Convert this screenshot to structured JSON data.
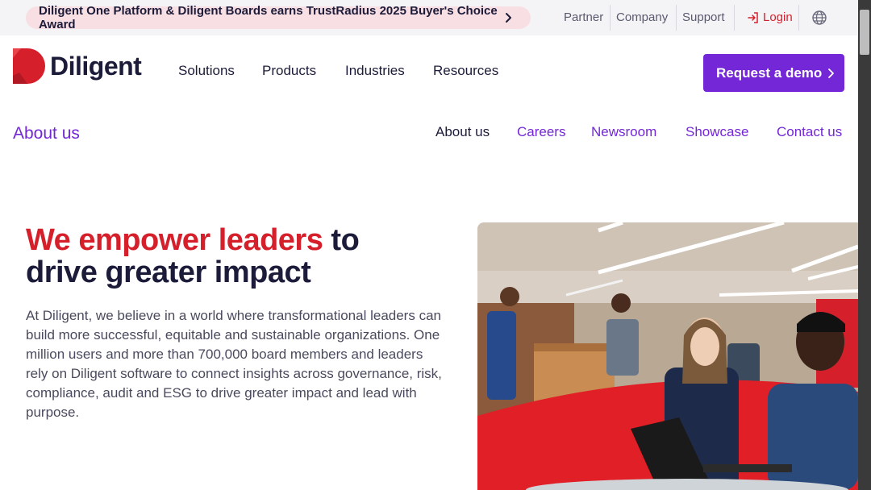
{
  "topbar": {
    "award_text": "Diligent One Platform & Diligent Boards earns TrustRadius 2025 Buyer's Choice Award",
    "links": [
      "Partner",
      "Company",
      "Support"
    ],
    "login_label": "Login"
  },
  "brand": {
    "name": "Diligent"
  },
  "nav": {
    "items": [
      "Solutions",
      "Products",
      "Industries",
      "Resources"
    ],
    "cta_label": "Request a demo"
  },
  "subnav": {
    "title": "About us",
    "items": [
      "About us",
      "Careers",
      "Newsroom",
      "Showcase",
      "Contact us"
    ]
  },
  "hero": {
    "headline_accent": "We empower leaders",
    "headline_rest_1": " to",
    "headline_rest_2": "drive greater impact",
    "body": "At Diligent, we believe in a world where transformational leaders can build more successful, equitable and sustainable organizations. One million users and more than 700,000 board members and leaders rely on Diligent software to connect insights across governance, risk, compliance, audit and ESG to drive greater impact and lead with purpose."
  },
  "colors": {
    "brand_red": "#d5202b",
    "brand_purple": "#7327d6",
    "navy": "#1c1c3a"
  }
}
